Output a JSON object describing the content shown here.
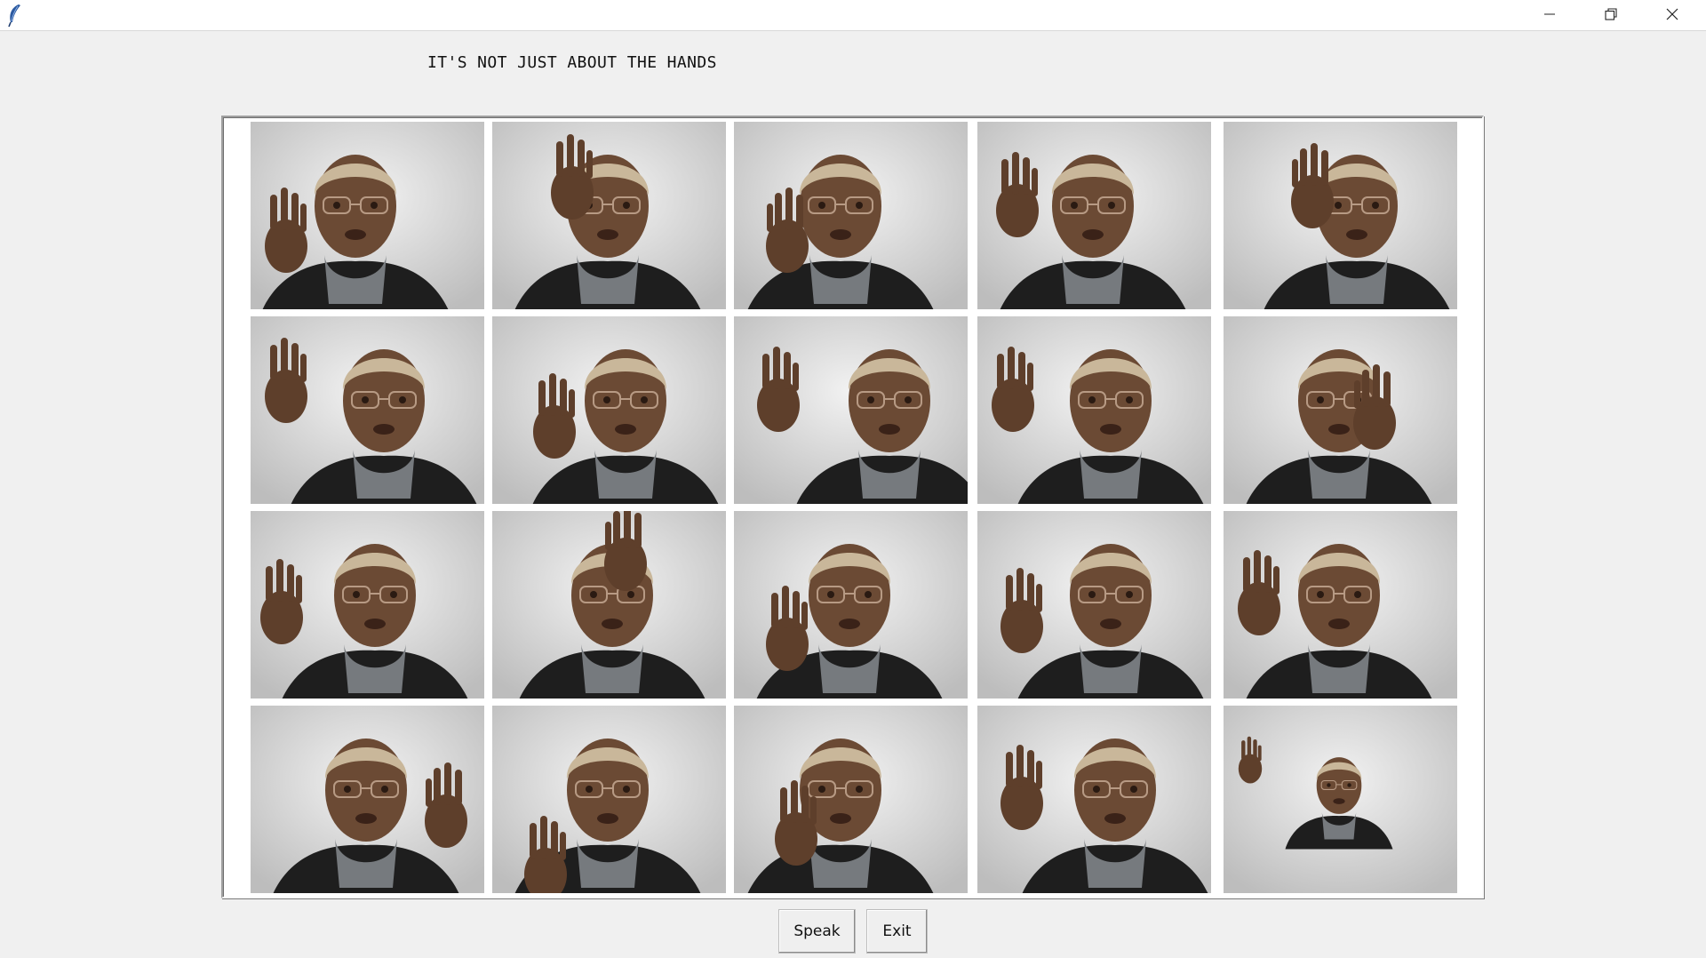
{
  "window": {
    "title": "",
    "app_icon": "feather-icon",
    "controls": [
      "minimize-icon",
      "restore-icon",
      "close-icon"
    ]
  },
  "heading": "IT'S NOT JUST ABOUT THE HANDS",
  "gallery": {
    "rows": 4,
    "columns": 5,
    "photos": [
      "sign-photo-1",
      "sign-photo-2",
      "sign-photo-3",
      "sign-photo-4",
      "sign-photo-5",
      "sign-photo-6",
      "sign-photo-7",
      "sign-photo-8",
      "sign-photo-9",
      "sign-photo-10",
      "sign-photo-11",
      "sign-photo-12",
      "sign-photo-13",
      "sign-photo-14",
      "sign-photo-15",
      "sign-photo-16",
      "sign-photo-17",
      "sign-photo-18",
      "sign-photo-19",
      "sign-photo-20"
    ]
  },
  "buttons": {
    "speak": "Speak",
    "exit": "Exit"
  },
  "colors": {
    "window_bg": "#f0f0f0",
    "titlebar_bg": "#ffffff",
    "panel_bg": "#ffffff",
    "photo_backdrop": "#e4e4e4",
    "skin": "#6b4a34",
    "hair": "#c9b79a",
    "clothing": "#1e1e1e",
    "scarf": "#767a7e"
  }
}
